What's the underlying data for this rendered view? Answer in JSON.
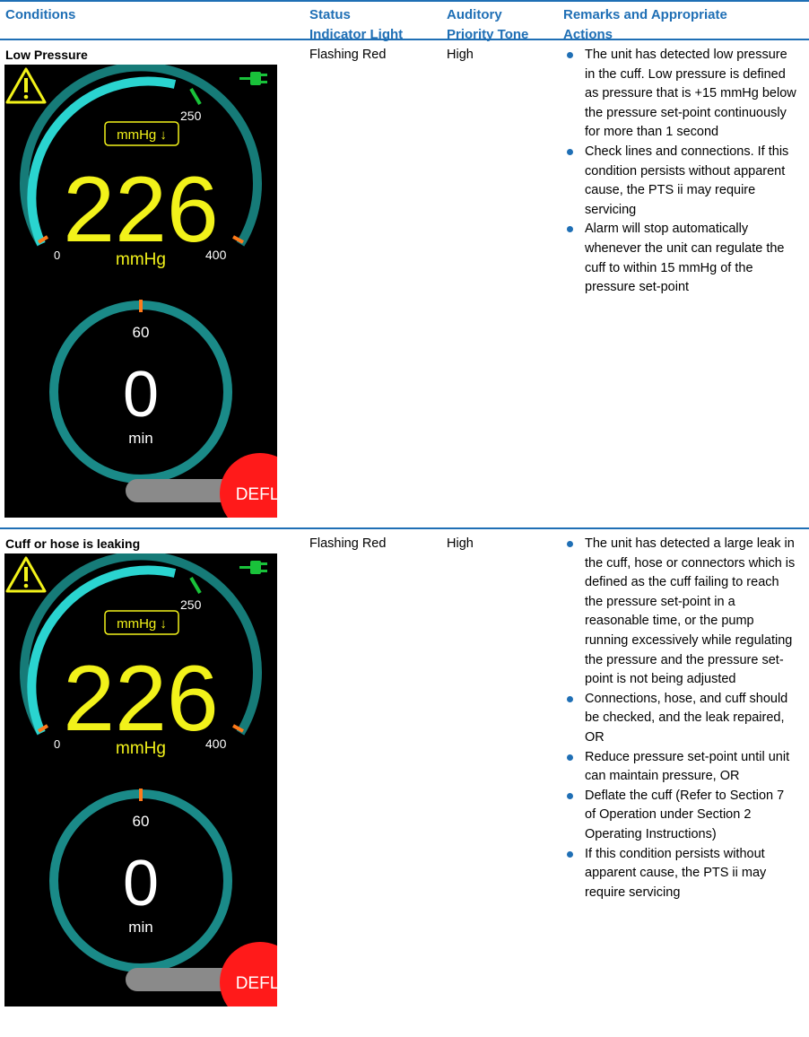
{
  "header": {
    "conditions": "Conditions",
    "status_line1": "Status",
    "status_line2": "Indicator Light",
    "tone_line1": "Auditory",
    "tone_line2": "Priority Tone",
    "remarks_line1": "Remarks and Appropriate",
    "remarks_line2": "Actions"
  },
  "rows": [
    {
      "condition": "Low Pressure",
      "status": "Flashing Red",
      "tone": "High",
      "remarks": [
        "The unit has detected low pressure in the cuff.  Low pressure is defined as pressure that is +15 mmHg below the pressure set-point continuously for more than 1 second",
        "Check lines and connections. If this condition persists without apparent cause, the PTS ii may require servicing",
        "Alarm will stop automatically whenever the unit can regulate the cuff to within 15 mmHg of the pressure set-point"
      ],
      "screen": {
        "pressure": "226",
        "pressure_unit": "mmHg",
        "setpoint_badge": "mmHg ↓",
        "gauge_min": "0",
        "gauge_mark": "250",
        "gauge_max": "400",
        "timer_label": "60",
        "timer_value": "0",
        "timer_unit": "min",
        "deflate_button": "DEFL"
      }
    },
    {
      "condition": "Cuff or hose is leaking",
      "status": "Flashing Red",
      "tone": "High",
      "remarks": [
        "The unit has detected a large leak in the cuff, hose or connectors which is defined as the cuff failing to reach the pressure set-point in a reasonable time, or the pump running excessively while regulating the pressure and the pressure set-point is not being adjusted",
        "Connections, hose, and cuff should be checked, and the leak repaired, OR",
        "Reduce pressure set-point until unit can maintain pressure, OR",
        "Deflate the cuff (Refer to Section 7 of Operation under Section 2 Operating Instructions)",
        "If this condition persists without apparent cause, the PTS ii may require servicing"
      ],
      "screen": {
        "pressure": "226",
        "pressure_unit": "mmHg",
        "setpoint_badge": "mmHg ↓",
        "gauge_min": "0",
        "gauge_mark": "250",
        "gauge_max": "400",
        "timer_label": "60",
        "timer_value": "0",
        "timer_unit": "min",
        "deflate_button": "DEFL"
      }
    }
  ],
  "colors": {
    "accent": "#1f6fb5",
    "gauge_fill": "#2ad4d0",
    "gauge_track": "#167b78",
    "pressure_text": "#f2f21a",
    "alarm_red": "#ff1a1a",
    "power_green": "#19c23a"
  },
  "icons": [
    "warning-icon",
    "power-plug-icon",
    "down-arrow-icon"
  ]
}
